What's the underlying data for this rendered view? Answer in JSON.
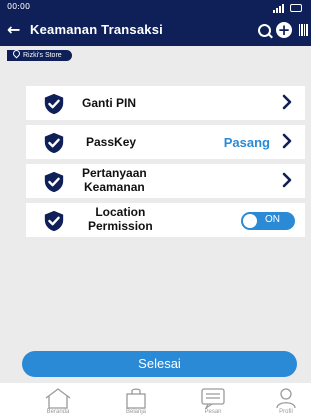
{
  "status_bar": {
    "time": "00:00"
  },
  "header": {
    "title": "Keamanan Transaksi"
  },
  "store": {
    "name": "Rizki's Store"
  },
  "menu": [
    {
      "label": "Ganti PIN"
    },
    {
      "label": "PassKey",
      "action": "Pasang"
    },
    {
      "label_line1": "Pertanyaan",
      "label_line2": "Keamanan"
    },
    {
      "label_line1": "Location",
      "label_line2": "Permission",
      "toggle": "ON",
      "toggle_on": true
    }
  ],
  "done_button": "Selesai",
  "nav": [
    {
      "label": "Beranda"
    },
    {
      "label": "Belanja"
    },
    {
      "label": "Pesan"
    },
    {
      "label": "Profil"
    }
  ],
  "colors": {
    "navy": "#0f1f57",
    "accent_blue": "#2a8ad6",
    "background": "#ebebeb"
  }
}
